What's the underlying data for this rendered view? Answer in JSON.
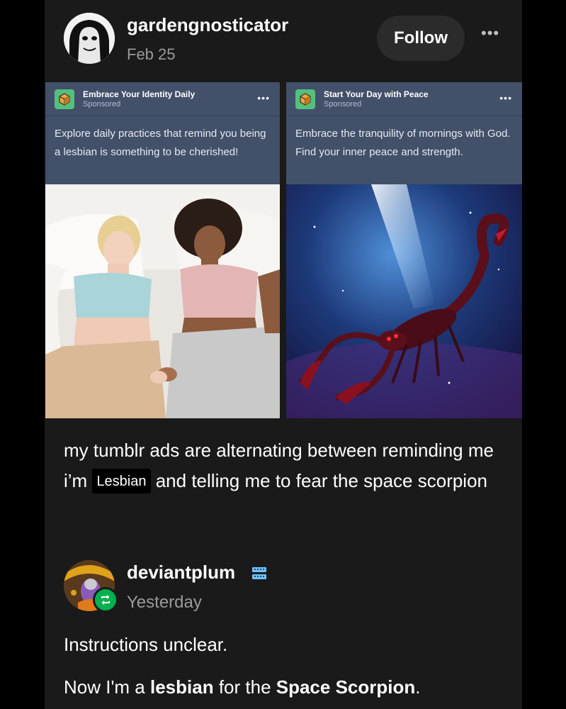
{
  "post": {
    "username": "gardengnosticator",
    "date": "Feb 25",
    "follow_label": "Follow",
    "more_icon": "more-dots-icon",
    "ads": [
      {
        "title": "Embrace Your Identity Daily",
        "sponsored": "Sponsored",
        "text": "Explore daily practices that remind you being a lesbian is something to be cherished!",
        "icon": "ad-cube-icon"
      },
      {
        "title": "Start Your Day with Peace",
        "sponsored": "Sponsored",
        "text": "Embrace the tranquility of mornings with God. Find your inner peace and strength.",
        "icon": "ad-cube-icon"
      }
    ],
    "text_part1": "my tumblr ads are alternating between reminding me i’m ",
    "tag_label": "Lesbian",
    "text_part2": " and telling me to fear the space scorpion"
  },
  "reblog": {
    "username": "deviantplum",
    "date": "Yesterday",
    "reply_line1": "Instructions unclear.",
    "reply_line2_a": "Now I'm a ",
    "reply_line2_bold1": "lesbian",
    "reply_line2_b": " for the ",
    "reply_line2_bold2": "Space Scorpion",
    "reply_line2_c": "."
  },
  "colors": {
    "background": "#000000",
    "post_background": "#1a1a1a",
    "ad_background": "#42506a",
    "reblog_green": "#00b04f",
    "secondary_text": "#9a9a9a"
  }
}
